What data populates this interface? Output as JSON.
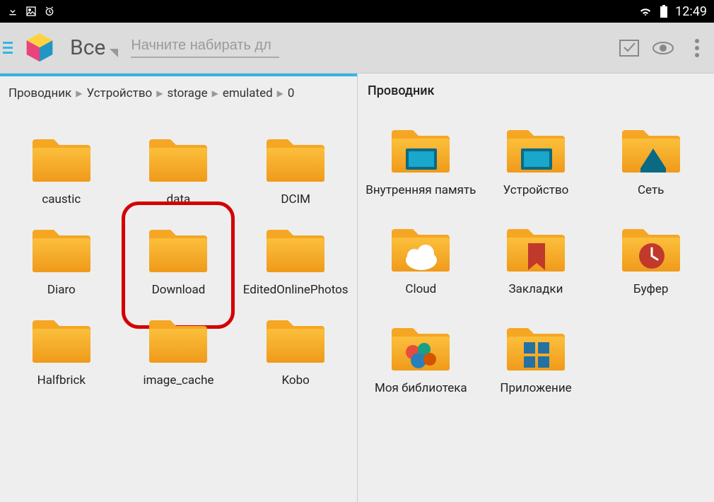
{
  "status": {
    "time": "12:49"
  },
  "toolbar": {
    "title": "Все",
    "search_placeholder": "Начните набирать дл"
  },
  "left": {
    "breadcrumbs": [
      "Проводник",
      "Устройство",
      "storage",
      "emulated",
      "0"
    ],
    "items": [
      {
        "label": "caustic"
      },
      {
        "label": "data"
      },
      {
        "label": "DCIM"
      },
      {
        "label": "Diaro"
      },
      {
        "label": "Download",
        "highlighted": true
      },
      {
        "label": "EditedOnlinePhotos"
      },
      {
        "label": "Halfbrick"
      },
      {
        "label": "image_cache"
      },
      {
        "label": "Kobo"
      }
    ]
  },
  "right": {
    "title": "Проводник",
    "items": [
      {
        "label": "Внутренняя память",
        "badge": "sdcard"
      },
      {
        "label": "Устройство",
        "badge": "sdcard"
      },
      {
        "label": "Сеть",
        "badge": "network"
      },
      {
        "label": "Cloud",
        "badge": "cloud"
      },
      {
        "label": "Закладки",
        "badge": "bookmark"
      },
      {
        "label": "Буфер",
        "badge": "clock"
      },
      {
        "label": "Моя библиотека",
        "badge": "circles"
      },
      {
        "label": "Приложение",
        "badge": "tiles"
      }
    ]
  }
}
